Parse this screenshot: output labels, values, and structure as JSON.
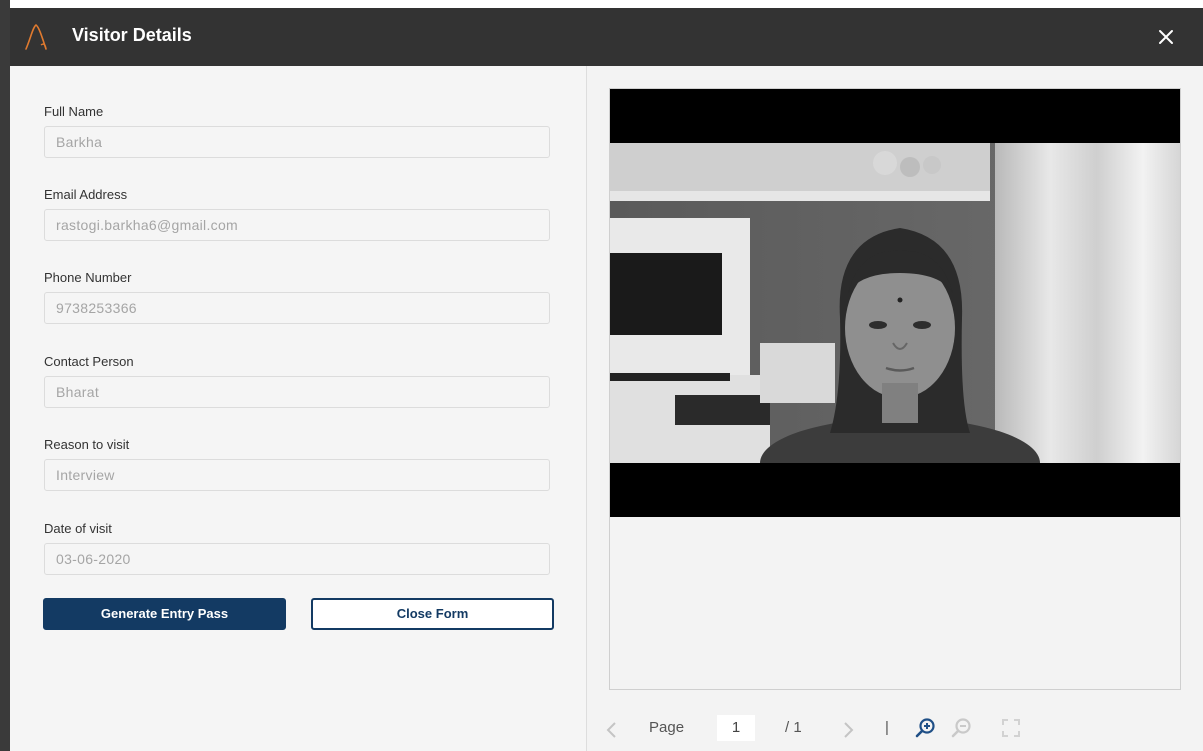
{
  "window": {
    "title": "Visitor Details",
    "icons": {
      "logo": "app-logo-icon",
      "close": "close-icon"
    }
  },
  "form": {
    "fields": [
      {
        "label": "Full Name",
        "value": "Barkha"
      },
      {
        "label": "Email Address",
        "value": "rastogi.barkha6@gmail.com"
      },
      {
        "label": "Phone Number",
        "value": "9738253366"
      },
      {
        "label": "Contact Person",
        "value": "Bharat"
      },
      {
        "label": "Reason to visit",
        "value": "Interview"
      },
      {
        "label": "Date of visit",
        "value": "03-06-2020"
      }
    ],
    "primary_button": "Generate Entry Pass",
    "secondary_button": "Close Form"
  },
  "viewer": {
    "page_label": "Page",
    "current_page": "1",
    "total_pages": "/ 1",
    "separator": "|",
    "icons": [
      "prev-page-icon",
      "next-page-icon",
      "zoom-in-icon",
      "zoom-out-icon",
      "fullscreen-icon"
    ]
  },
  "colors": {
    "titlebar": "#333333",
    "primary": "#133a63",
    "panel_bg": "#f5f5f5",
    "logo_accent": "#e07a2f"
  }
}
